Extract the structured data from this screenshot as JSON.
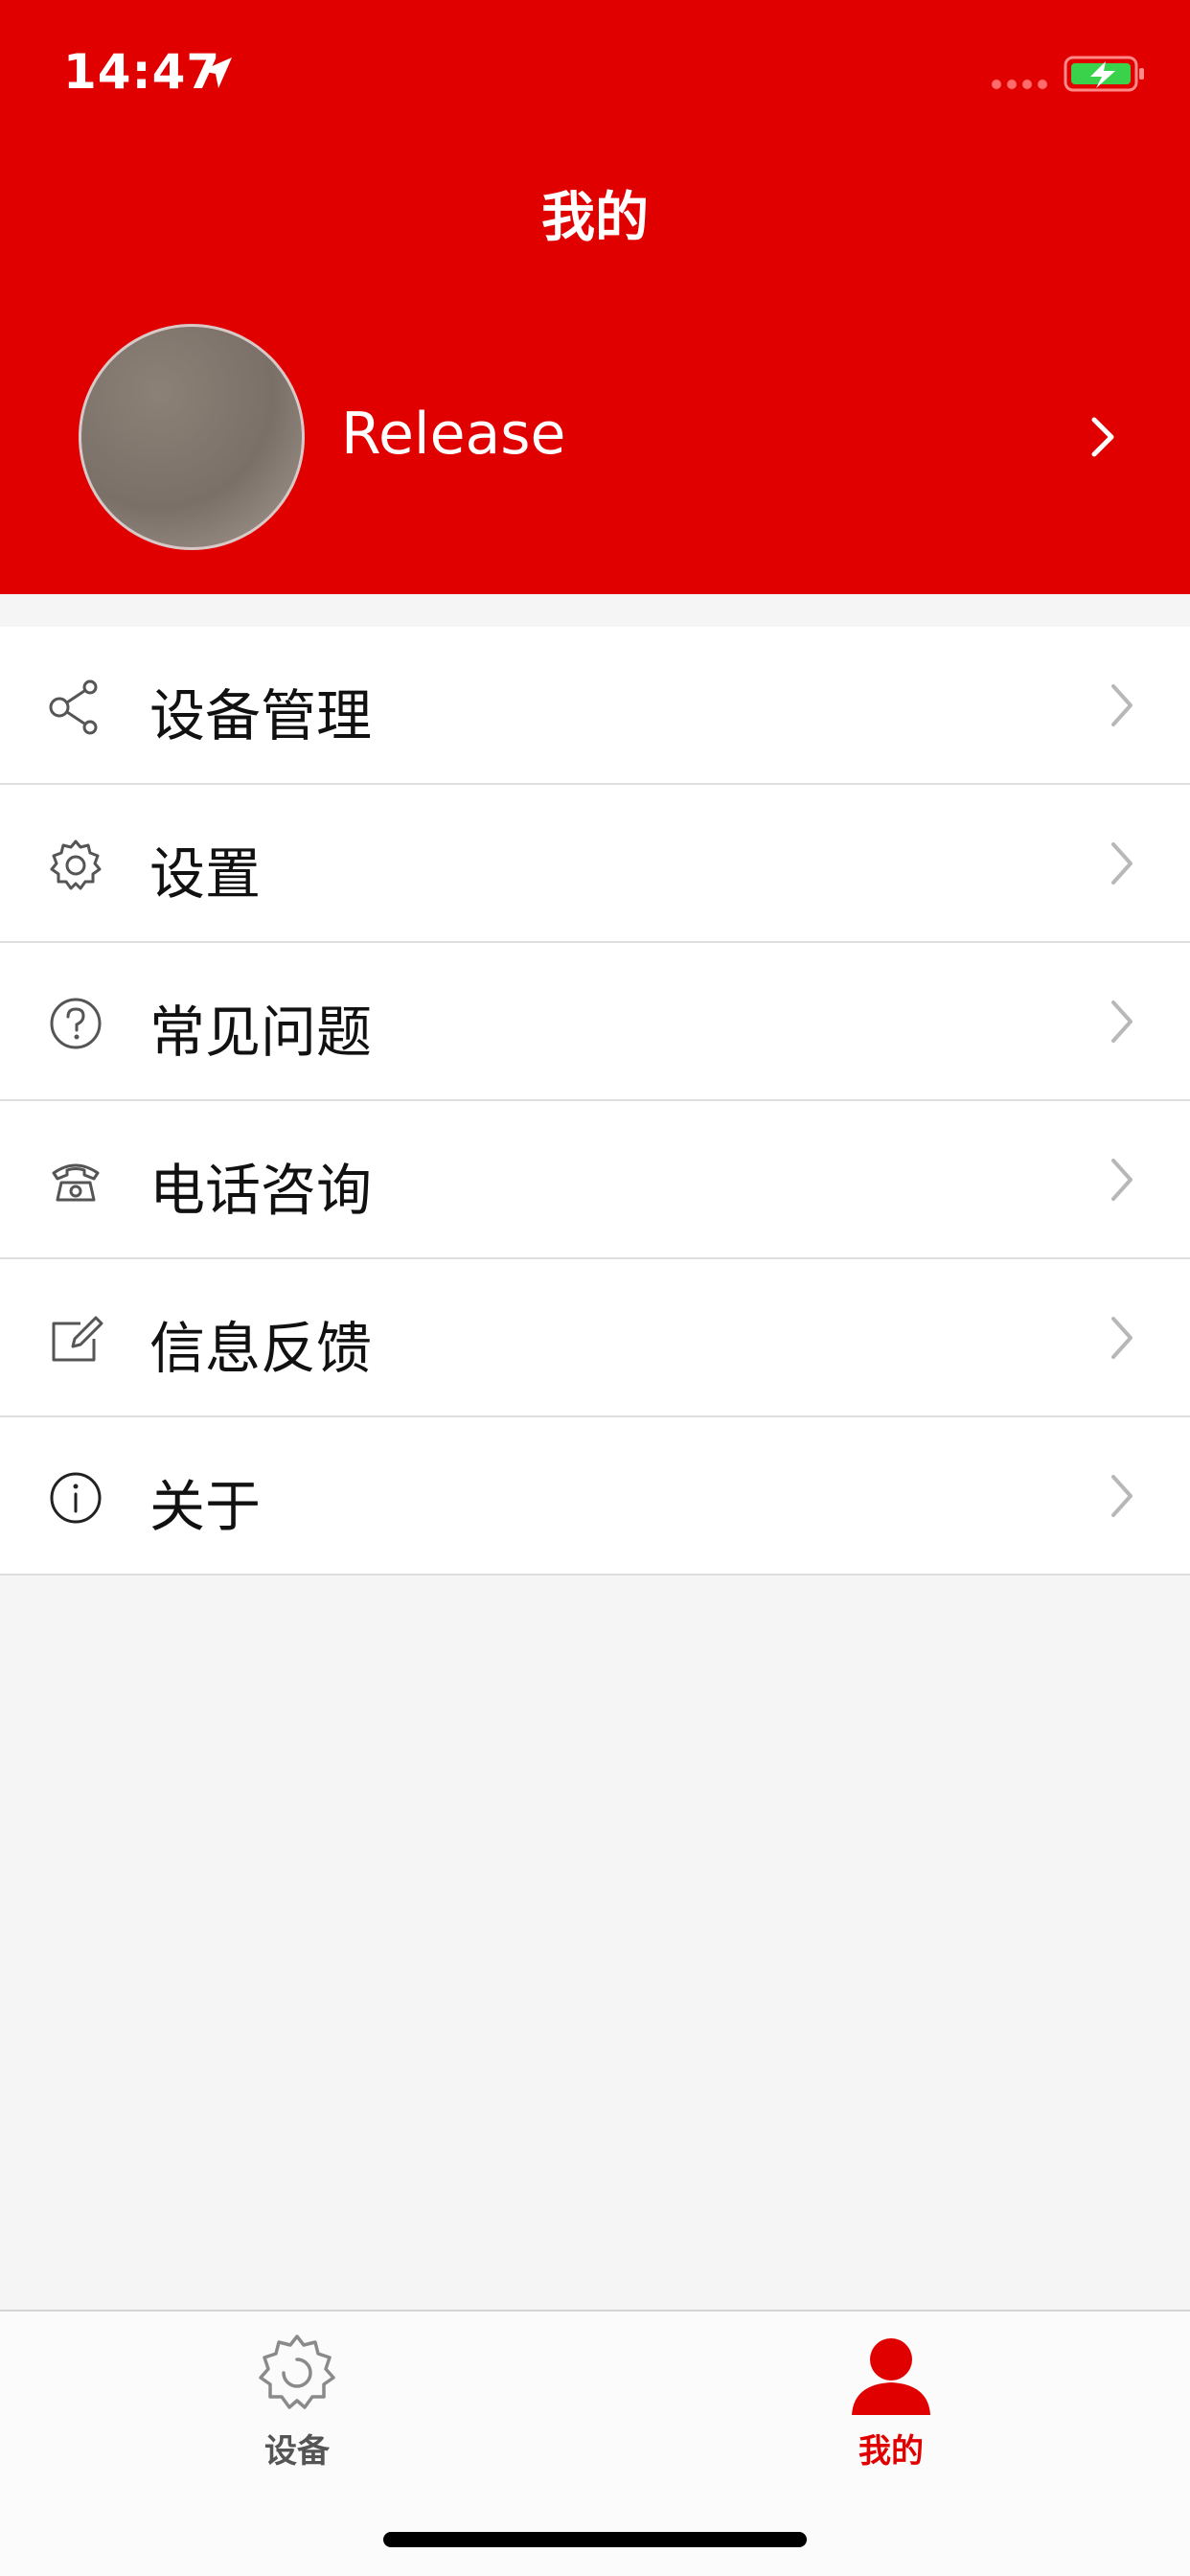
{
  "status_bar": {
    "time": "14:47",
    "icons": [
      "location-arrow-icon",
      "signal-icon",
      "battery-charging-icon"
    ]
  },
  "header": {
    "title": "我的",
    "background_color": "#e10000"
  },
  "profile": {
    "name": "Release",
    "avatar": "avatar-image",
    "chevron": "chevron-right-icon"
  },
  "menu": {
    "items": [
      {
        "label": "设备管理",
        "icon": "share-icon"
      },
      {
        "label": "设置",
        "icon": "gear-icon"
      },
      {
        "label": "常见问题",
        "icon": "question-circle-icon"
      },
      {
        "label": "电话咨询",
        "icon": "telephone-icon"
      },
      {
        "label": "信息反馈",
        "icon": "edit-icon"
      },
      {
        "label": "关于",
        "icon": "info-circle-icon"
      }
    ]
  },
  "tab_bar": {
    "tabs": [
      {
        "label": "设备",
        "icon": "gear-icon",
        "active": false
      },
      {
        "label": "我的",
        "icon": "person-icon",
        "active": true
      }
    ],
    "active_color": "#e10000",
    "inactive_color": "#555555"
  }
}
